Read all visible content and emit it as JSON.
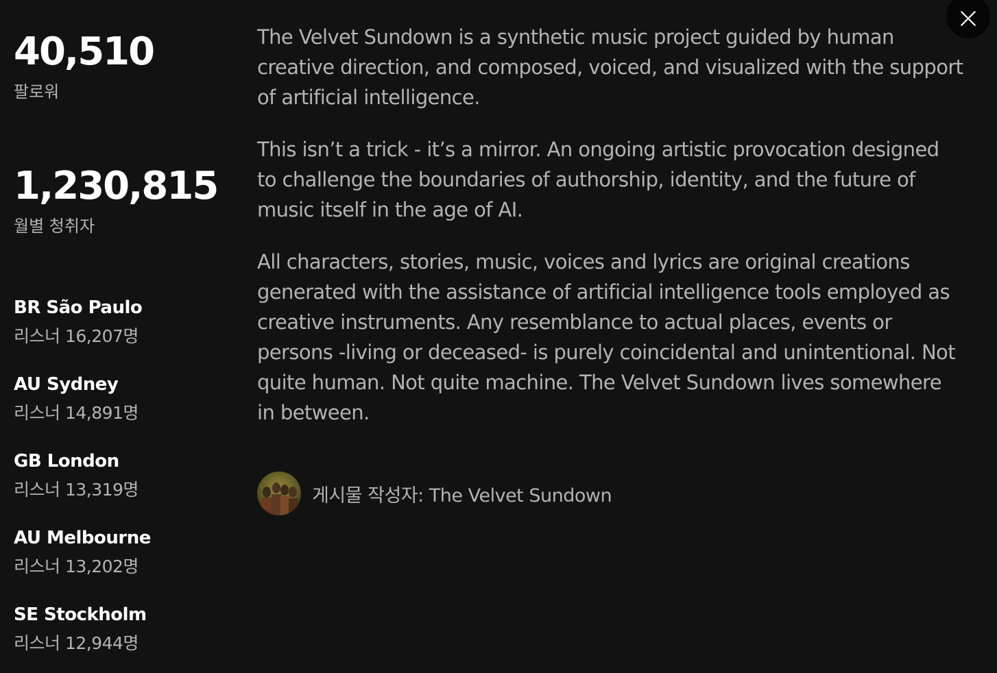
{
  "stats": {
    "followers_value": "40,510",
    "followers_label": "팔로워",
    "monthly_value": "1,230,815",
    "monthly_label": "월별 청취자"
  },
  "cities": [
    {
      "name": "BR São Paulo",
      "listeners": "리스너 16,207명"
    },
    {
      "name": "AU Sydney",
      "listeners": "리스너 14,891명"
    },
    {
      "name": "GB London",
      "listeners": "리스너 13,319명"
    },
    {
      "name": "AU Melbourne",
      "listeners": "리스너 13,202명"
    },
    {
      "name": "SE Stockholm",
      "listeners": "리스너 12,944명"
    }
  ],
  "bio": {
    "paragraphs": [
      "The Velvet Sundown is a synthetic music project guided by human creative direction, and composed, voiced, and visualized with the support of artificial intelligence.",
      "This isn’t a trick - it’s a mirror. An ongoing artistic provocation designed to challenge the boundaries of authorship, identity, and the future of music itself in the age of AI.",
      "All characters, stories, music, voices and lyrics are original creations generated with the assistance of artificial intelligence tools employed as creative instruments. Any resemblance to actual places, events or persons -living or deceased- is purely coincidental and unintentional. Not quite human. Not quite machine. The Velvet Sundown lives somewhere in between."
    ]
  },
  "author": {
    "label": "게시물 작성자: The Velvet Sundown"
  },
  "icons": {
    "close": "close-icon",
    "avatar": "avatar"
  },
  "colors": {
    "background": "#121212",
    "primary_text": "#ffffff",
    "secondary_text": "#b3b3b3",
    "close_button_bg": "#050505"
  }
}
